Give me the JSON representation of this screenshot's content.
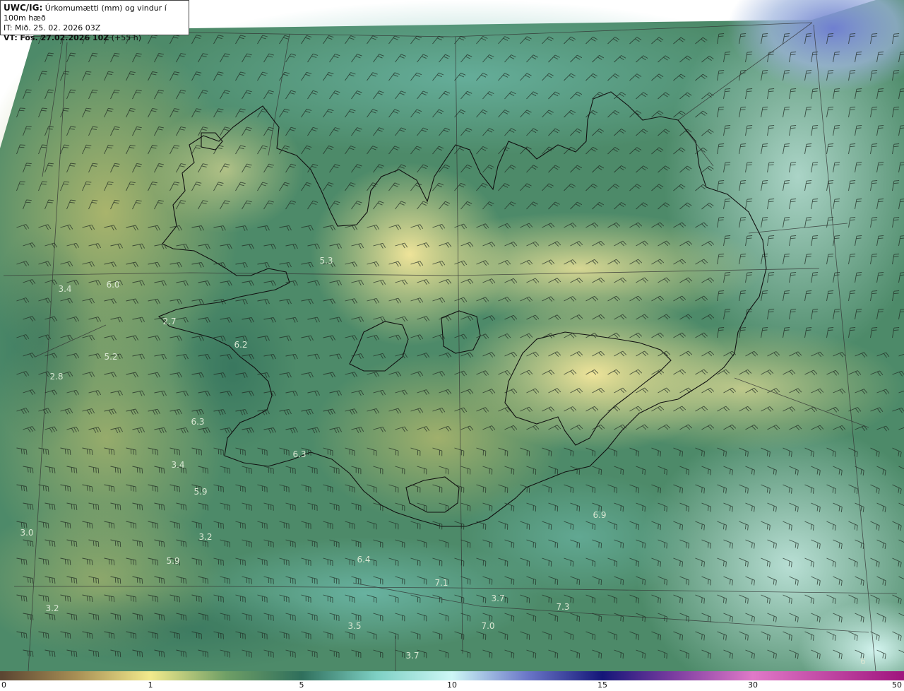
{
  "header": {
    "product": "UWC/IG:",
    "title": "Úrkomumætti (mm) og vindur í 100m hæð",
    "issue_time": "IT: Mið. 25. 02. 2026 03Z",
    "valid_label": "VT:",
    "valid_time_bold": "Fös. 27.02.2026 10Z",
    "valid_time_rest": "(+55 h)"
  },
  "colorbar": {
    "ticks": [
      "0",
      "1",
      "5",
      "10",
      "15",
      "30",
      "50"
    ],
    "stops": [
      {
        "value": 0,
        "color": "#5b4632"
      },
      {
        "value": 0.5,
        "color": "#a88f55"
      },
      {
        "value": 1,
        "color": "#f2ea8c"
      },
      {
        "value": 3,
        "color": "#6f9f66"
      },
      {
        "value": 5,
        "color": "#2f6f5c"
      },
      {
        "value": 7.5,
        "color": "#7ed0c4"
      },
      {
        "value": 10,
        "color": "#cdf7f6"
      },
      {
        "value": 12.5,
        "color": "#6b77c8"
      },
      {
        "value": 15,
        "color": "#141678"
      },
      {
        "value": 22,
        "color": "#7a3ca0"
      },
      {
        "value": 30,
        "color": "#e079c8"
      },
      {
        "value": 50,
        "color": "#a0157e"
      }
    ]
  },
  "map_labels": [
    {
      "text": "5.3"
    },
    {
      "text": "3.4"
    },
    {
      "text": "6.0"
    },
    {
      "text": "2.7"
    },
    {
      "text": "6.2"
    },
    {
      "text": "5.2"
    },
    {
      "text": "2.8"
    },
    {
      "text": "6.3"
    },
    {
      "text": "6.3"
    },
    {
      "text": "3.4"
    },
    {
      "text": "5.9"
    },
    {
      "text": "3.0"
    },
    {
      "text": "3.2"
    },
    {
      "text": "5.9"
    },
    {
      "text": "3.2"
    },
    {
      "text": "6.4"
    },
    {
      "text": "6.9"
    },
    {
      "text": "7.1"
    },
    {
      "text": "3.7"
    },
    {
      "text": "7.3"
    },
    {
      "text": "7.0"
    },
    {
      "text": "3.5"
    },
    {
      "text": "3.7"
    },
    {
      "text": "6"
    }
  ]
}
